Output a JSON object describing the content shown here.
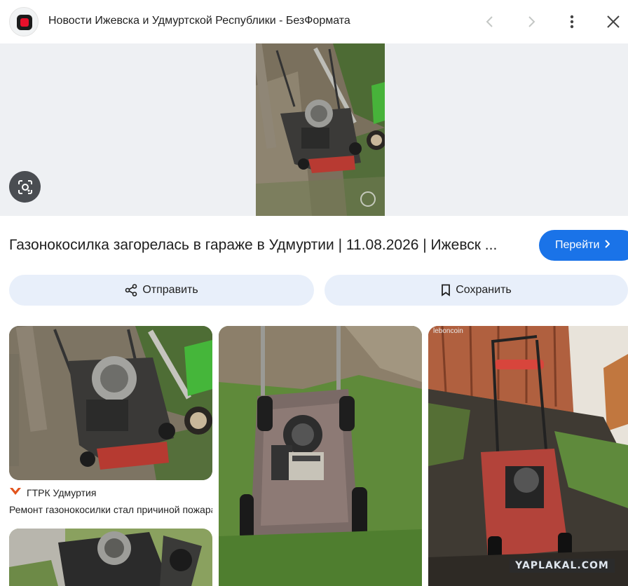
{
  "header": {
    "site_title": "Новости Ижевска и Удмуртской Республики - БезФормата",
    "favicon_icon": "bezformata-favicon",
    "back_icon": "chevron-left-icon",
    "forward_icon": "chevron-right-icon",
    "more_icon": "more-vertical-icon",
    "close_icon": "close-icon"
  },
  "hero": {
    "lens_icon": "lens-search-icon"
  },
  "result": {
    "title": "Газонокосилка загорелась в гараже в Удмуртии | 11.08.2026 | Ижевск ...",
    "go_label": "Перейти",
    "go_icon": "chevron-right-icon"
  },
  "actions": {
    "share_label": "Отправить",
    "share_icon": "share-icon",
    "save_label": "Сохранить",
    "save_icon": "bookmark-icon"
  },
  "related": [
    {
      "source": "ГТРК Удмуртия",
      "source_icon": "gtrk-logo-icon",
      "description": "Ремонт газонокосилки стал причиной пожара"
    }
  ],
  "overlays": {
    "watermark": "YAPLAKAL.COM",
    "leboncoin": "leboncoin"
  },
  "colors": {
    "accent": "#1a73e8",
    "action_bg": "#e8effa",
    "hero_bg": "#eef0f3"
  }
}
